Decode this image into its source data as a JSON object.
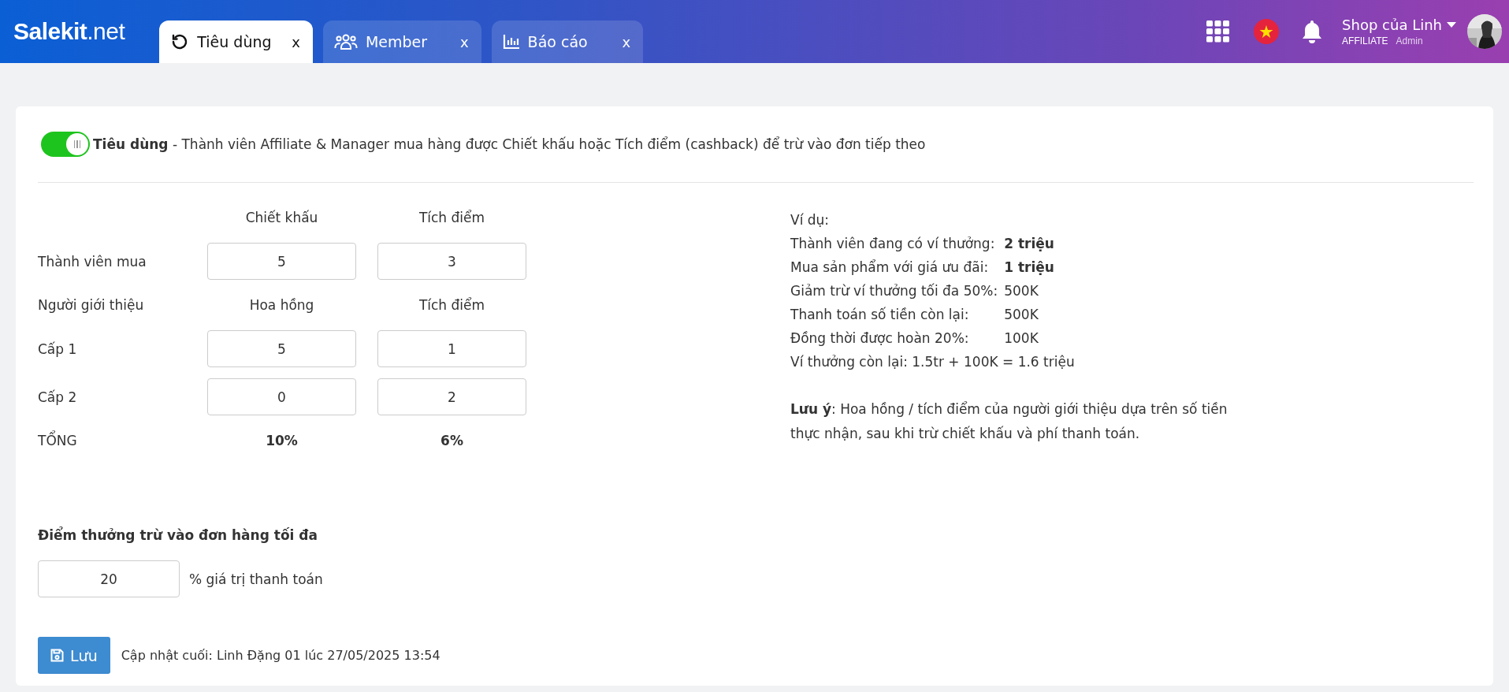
{
  "header": {
    "logo": "**Salekit**.net",
    "tabs": [
      {
        "label": "Tiêu dùng",
        "kind": "history",
        "selected": true,
        "close": "x"
      },
      {
        "label": "Member",
        "kind": "users",
        "selected": false,
        "close": "x"
      },
      {
        "label": "Báo cáo",
        "kind": "chart",
        "selected": false,
        "close": "x"
      }
    ],
    "user": {
      "name": "Shop của Linh",
      "role": "AFFILIATE",
      "account_type": "Admin"
    }
  },
  "settings": {
    "toggle": {
      "on": true
    },
    "description": "**Tiêu dùng** - Thành viên Affiliate & Manager mua hàng được Chiết khấu hoặc Tích điểm (cashback) để trừ vào đơn tiếp theo",
    "rates": {
      "buyer_columns": [
        "Chiết khấu",
        "Tích điểm"
      ],
      "buyer": {
        "label": "Thành viên mua",
        "values": [
          "5",
          "3"
        ]
      },
      "referrer": {
        "label": "Người giới thiệu",
        "columns": [
          "Hoa hồng",
          "Tích điểm"
        ]
      },
      "levels": [
        {
          "label": "Cấp 1",
          "values": [
            "5",
            "1"
          ]
        },
        {
          "label": "Cấp 2",
          "values": [
            "0",
            "2"
          ]
        }
      ],
      "total": {
        "label": "TỔNG",
        "values": [
          "10%",
          "6%"
        ]
      }
    },
    "example": {
      "title": "Ví dụ:",
      "lines": [
        {
          "label": "Thành viên đang có ví thưởng:",
          "value": "2 triệu",
          "bold": true
        },
        {
          "label": "Mua sản phẩm với giá ưu đãi:",
          "value": "1 triệu",
          "bold": true
        },
        {
          "label": "Giảm trừ ví thưởng tối đa 50%:",
          "value": "500K",
          "bold": false
        },
        {
          "label": "Thanh toán số tiền còn lại:",
          "value": "500K",
          "bold": false
        },
        {
          "label": "Đồng thời được hoàn 20%:",
          "value": "100K",
          "bold": false
        }
      ],
      "summary": "Ví thưởng còn lại: 1.5tr + 100K = 1.6 triệu",
      "note": "**Lưu ý**: Hoa hồng / tích điểm của người giới thiệu dựa trên số tiền thực nhận, sau khi trừ chiết khấu và phí thanh toán."
    },
    "max_points": {
      "label": "Điểm thưởng trừ vào đơn hàng tối đa",
      "value": "20",
      "suffix": "% giá trị thanh toán"
    },
    "save_button": "Lưu",
    "last_updated": "Cập nhật cuối: Linh Đặng 01 lúc 27/05/2025 13:54"
  }
}
